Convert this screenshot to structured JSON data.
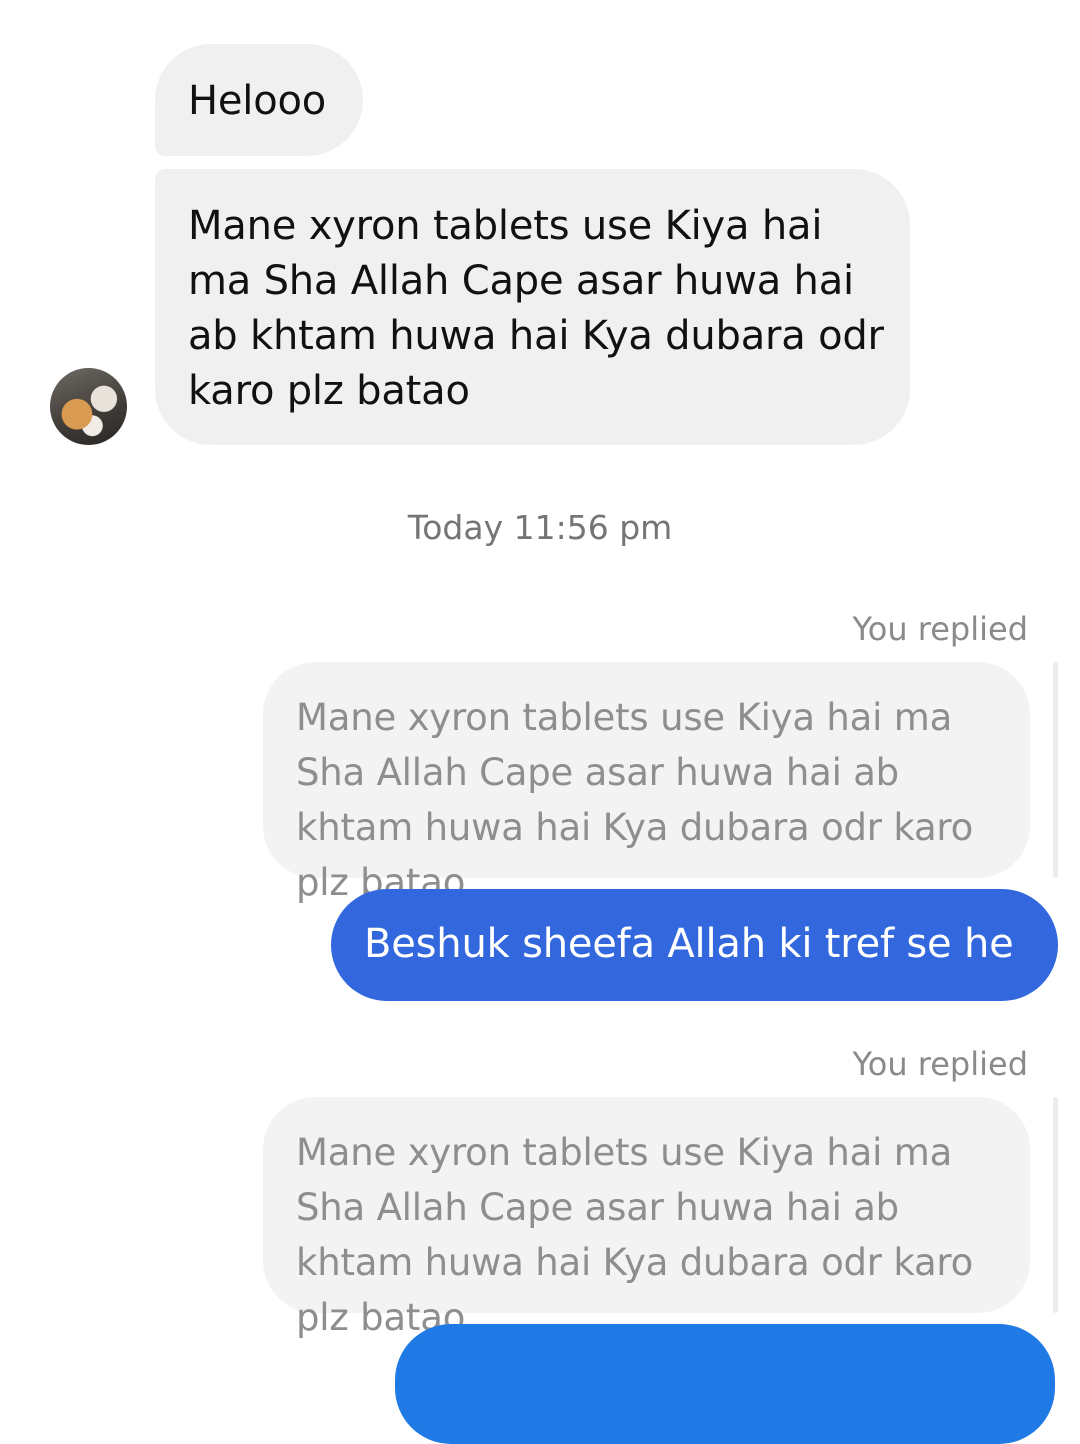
{
  "conversation": {
    "incoming_messages": [
      {
        "text": "Helooo"
      },
      {
        "text": "Mane xyron tablets use Kiya hai ma Sha Allah Cape asar huwa hai ab khtam huwa hai Kya dubara odr karo plz batao"
      }
    ],
    "timestamp": "Today 11:56 pm",
    "replies": [
      {
        "label": "You replied",
        "quoted_text": "Mane xyron tablets use Kiya hai ma Sha Allah Cape asar huwa hai ab khtam huwa hai Kya dubara odr karo plz batao",
        "reply_text": "Beshuk sheefa Allah ki tref se he"
      },
      {
        "label": "You replied",
        "quoted_text": "Mane xyron tablets use Kiya hai ma Sha Allah Cape asar huwa hai ab khtam huwa hai Kya dubara odr karo plz batao",
        "reply_text": ""
      }
    ]
  },
  "colors": {
    "incoming_bubble": "#f0f0f0",
    "quoted_bubble": "#f3f3f3",
    "outgoing_bubble": "#3267de",
    "timestamp_text": "#757575"
  },
  "icons": {
    "avatar": "contact-avatar-photo"
  }
}
